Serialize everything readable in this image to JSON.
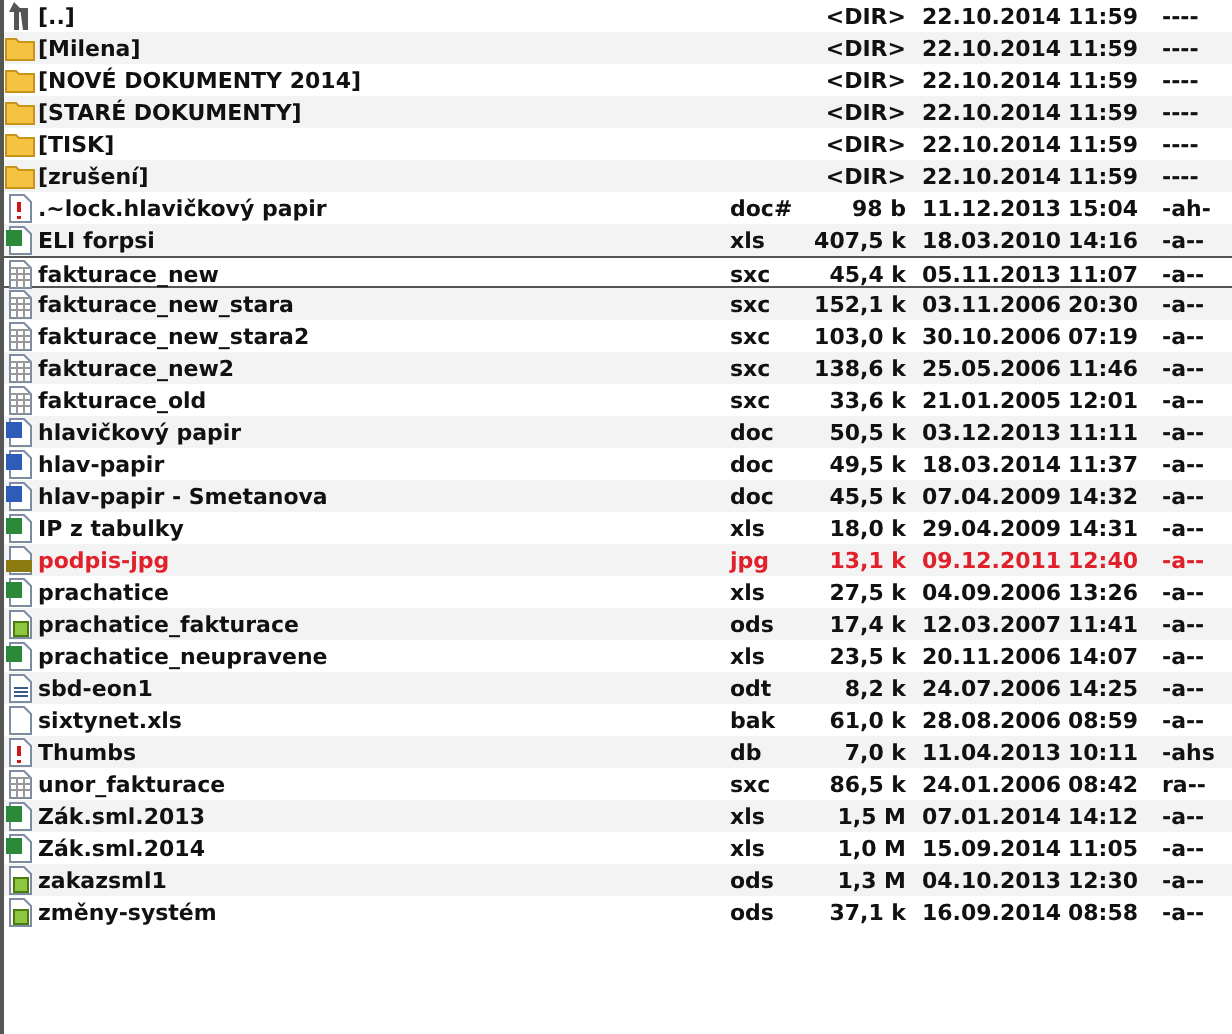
{
  "files": [
    {
      "kind": "parent",
      "name": "[..]",
      "size": "<DIR>",
      "date": "22.10.2014",
      "time": "11:59",
      "attr": "----",
      "focused": false,
      "selected": false
    },
    {
      "kind": "folder",
      "name": "[Milena]",
      "size": "<DIR>",
      "date": "22.10.2014",
      "time": "11:59",
      "attr": "----",
      "focused": false,
      "selected": false
    },
    {
      "kind": "folder",
      "name": "[NOVÉ DOKUMENTY 2014]",
      "size": "<DIR>",
      "date": "22.10.2014",
      "time": "11:59",
      "attr": "----",
      "focused": false,
      "selected": false
    },
    {
      "kind": "folder",
      "name": "[STARÉ DOKUMENTY]",
      "size": "<DIR>",
      "date": "22.10.2014",
      "time": "11:59",
      "attr": "----",
      "focused": false,
      "selected": false
    },
    {
      "kind": "folder",
      "name": "[TISK]",
      "size": "<DIR>",
      "date": "22.10.2014",
      "time": "11:59",
      "attr": "----",
      "focused": false,
      "selected": false
    },
    {
      "kind": "folder",
      "name": "[zrušení]",
      "size": "<DIR>",
      "date": "22.10.2014",
      "time": "11:59",
      "attr": "----",
      "focused": false,
      "selected": false
    },
    {
      "kind": "system",
      "name": ".~lock.hlavičkový papir",
      "ext": "doc#",
      "size": "98 b",
      "date": "11.12.2013",
      "time": "15:04",
      "attr": "-ah-",
      "focused": false,
      "selected": false
    },
    {
      "kind": "excel",
      "name": "ELI forpsi",
      "ext": "xls",
      "size": "407,5 k",
      "date": "18.03.2010",
      "time": "14:16",
      "attr": "-a--",
      "focused": false,
      "selected": false
    },
    {
      "kind": "grid",
      "name": "fakturace_new",
      "ext": "sxc",
      "size": "45,4 k",
      "date": "05.11.2013",
      "time": "11:07",
      "attr": "-a--",
      "focused": true,
      "selected": false
    },
    {
      "kind": "grid",
      "name": "fakturace_new_stara",
      "ext": "sxc",
      "size": "152,1 k",
      "date": "03.11.2006",
      "time": "20:30",
      "attr": "-a--",
      "focused": false,
      "selected": false
    },
    {
      "kind": "grid",
      "name": "fakturace_new_stara2",
      "ext": "sxc",
      "size": "103,0 k",
      "date": "30.10.2006",
      "time": "07:19",
      "attr": "-a--",
      "focused": false,
      "selected": false
    },
    {
      "kind": "grid",
      "name": "fakturace_new2",
      "ext": "sxc",
      "size": "138,6 k",
      "date": "25.05.2006",
      "time": "11:46",
      "attr": "-a--",
      "focused": false,
      "selected": false
    },
    {
      "kind": "grid",
      "name": "fakturace_old",
      "ext": "sxc",
      "size": "33,6 k",
      "date": "21.01.2005",
      "time": "12:01",
      "attr": "-a--",
      "focused": false,
      "selected": false
    },
    {
      "kind": "word",
      "name": "hlavičkový papir",
      "ext": "doc",
      "size": "50,5 k",
      "date": "03.12.2013",
      "time": "11:11",
      "attr": "-a--",
      "focused": false,
      "selected": false
    },
    {
      "kind": "word",
      "name": "hlav-papir",
      "ext": "doc",
      "size": "49,5 k",
      "date": "18.03.2014",
      "time": "11:37",
      "attr": "-a--",
      "focused": false,
      "selected": false
    },
    {
      "kind": "word",
      "name": "hlav-papir - Smetanova",
      "ext": "doc",
      "size": "45,5 k",
      "date": "07.04.2009",
      "time": "14:32",
      "attr": "-a--",
      "focused": false,
      "selected": false
    },
    {
      "kind": "excel",
      "name": "IP z tabulky",
      "ext": "xls",
      "size": "18,0 k",
      "date": "29.04.2009",
      "time": "14:31",
      "attr": "-a--",
      "focused": false,
      "selected": false
    },
    {
      "kind": "image",
      "name": "podpis-jpg",
      "ext": "jpg",
      "size": "13,1 k",
      "date": "09.12.2011",
      "time": "12:40",
      "attr": "-a--",
      "focused": false,
      "selected": true
    },
    {
      "kind": "excel",
      "name": "prachatice",
      "ext": "xls",
      "size": "27,5 k",
      "date": "04.09.2006",
      "time": "13:26",
      "attr": "-a--",
      "focused": false,
      "selected": false
    },
    {
      "kind": "calc",
      "name": "prachatice_fakturace",
      "ext": "ods",
      "size": "17,4 k",
      "date": "12.03.2007",
      "time": "11:41",
      "attr": "-a--",
      "focused": false,
      "selected": false
    },
    {
      "kind": "excel",
      "name": "prachatice_neupravene",
      "ext": "xls",
      "size": "23,5 k",
      "date": "20.11.2006",
      "time": "14:07",
      "attr": "-a--",
      "focused": false,
      "selected": false
    },
    {
      "kind": "writer",
      "name": "sbd-eon1",
      "ext": "odt",
      "size": "8,2 k",
      "date": "24.07.2006",
      "time": "14:25",
      "attr": "-a--",
      "focused": false,
      "selected": false
    },
    {
      "kind": "blank",
      "name": "sixtynet.xls",
      "ext": "bak",
      "size": "61,0 k",
      "date": "28.08.2006",
      "time": "08:59",
      "attr": "-a--",
      "focused": false,
      "selected": false
    },
    {
      "kind": "system",
      "name": "Thumbs",
      "ext": "db",
      "size": "7,0 k",
      "date": "11.04.2013",
      "time": "10:11",
      "attr": "-ahs",
      "focused": false,
      "selected": false
    },
    {
      "kind": "grid",
      "name": "unor_fakturace",
      "ext": "sxc",
      "size": "86,5 k",
      "date": "24.01.2006",
      "time": "08:42",
      "attr": "ra--",
      "focused": false,
      "selected": false
    },
    {
      "kind": "excel",
      "name": "Zák.sml.2013",
      "ext": "xls",
      "size": "1,5 M",
      "date": "07.01.2014",
      "time": "14:12",
      "attr": "-a--",
      "focused": false,
      "selected": false
    },
    {
      "kind": "excel",
      "name": "Zák.sml.2014",
      "ext": "xls",
      "size": "1,0 M",
      "date": "15.09.2014",
      "time": "11:05",
      "attr": "-a--",
      "focused": false,
      "selected": false
    },
    {
      "kind": "calc",
      "name": "zakazsml1",
      "ext": "ods",
      "size": "1,3 M",
      "date": "04.10.2013",
      "time": "12:30",
      "attr": "-a--",
      "focused": false,
      "selected": false
    },
    {
      "kind": "calc",
      "name": "změny-systém",
      "ext": "ods",
      "size": "37,1 k",
      "date": "16.09.2014",
      "time": "08:58",
      "attr": "-a--",
      "focused": false,
      "selected": false
    }
  ]
}
